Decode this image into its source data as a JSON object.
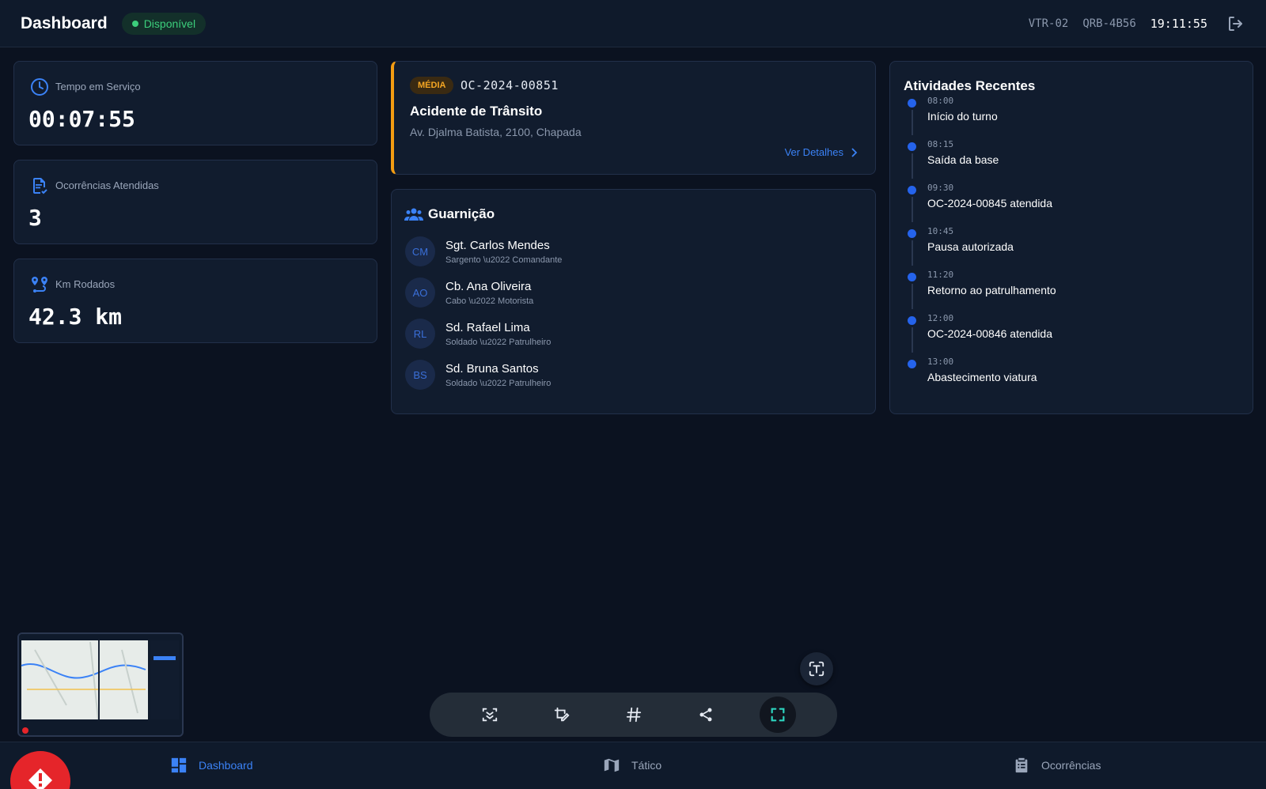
{
  "header": {
    "title": "Dashboard",
    "status": "Disponível",
    "vehicle": "VTR-02",
    "plate": "QRB-4B56",
    "clock": "19:11:55"
  },
  "stats": [
    {
      "label": "Tempo em Serviço",
      "value": "00:07:55",
      "icon": "clock-icon"
    },
    {
      "label": "Ocorrências Atendidas",
      "value": "3",
      "icon": "document-check-icon"
    },
    {
      "label": "Km Rodados",
      "value": "42.3 km",
      "icon": "route-icon"
    }
  ],
  "occurrence": {
    "priority": "MÉDIA",
    "code": "OC-2024-00851",
    "title": "Acidente de Trânsito",
    "address": "Av. Djalma Batista, 2100, Chapada",
    "details_label": "Ver Detalhes"
  },
  "crew": {
    "title": "Guarnição",
    "members": [
      {
        "initials": "CM",
        "name": "Sgt. Carlos Mendes",
        "role": "Sargento \\u2022 Comandante"
      },
      {
        "initials": "AO",
        "name": "Cb. Ana Oliveira",
        "role": "Cabo \\u2022 Motorista"
      },
      {
        "initials": "RL",
        "name": "Sd. Rafael Lima",
        "role": "Soldado \\u2022 Patrulheiro"
      },
      {
        "initials": "BS",
        "name": "Sd. Bruna Santos",
        "role": "Soldado \\u2022 Patrulheiro"
      }
    ]
  },
  "activities": {
    "title": "Atividades Recentes",
    "items": [
      {
        "time": "08:00",
        "text": "Início do turno"
      },
      {
        "time": "08:15",
        "text": "Saída da base"
      },
      {
        "time": "09:30",
        "text": "OC-2024-00845 atendida"
      },
      {
        "time": "10:45",
        "text": "Pausa autorizada"
      },
      {
        "time": "11:20",
        "text": "Retorno ao patrulhamento"
      },
      {
        "time": "12:00",
        "text": "OC-2024-00846 atendida"
      },
      {
        "time": "13:00",
        "text": "Abastecimento viatura"
      }
    ]
  },
  "nav": {
    "dashboard": "Dashboard",
    "tactical": "Tático",
    "occurrences": "Ocorrências"
  },
  "colors": {
    "accent": "#3b82f6",
    "available": "#3ccf7c",
    "priority_medium": "#f39c12",
    "panic": "#e5252a"
  }
}
